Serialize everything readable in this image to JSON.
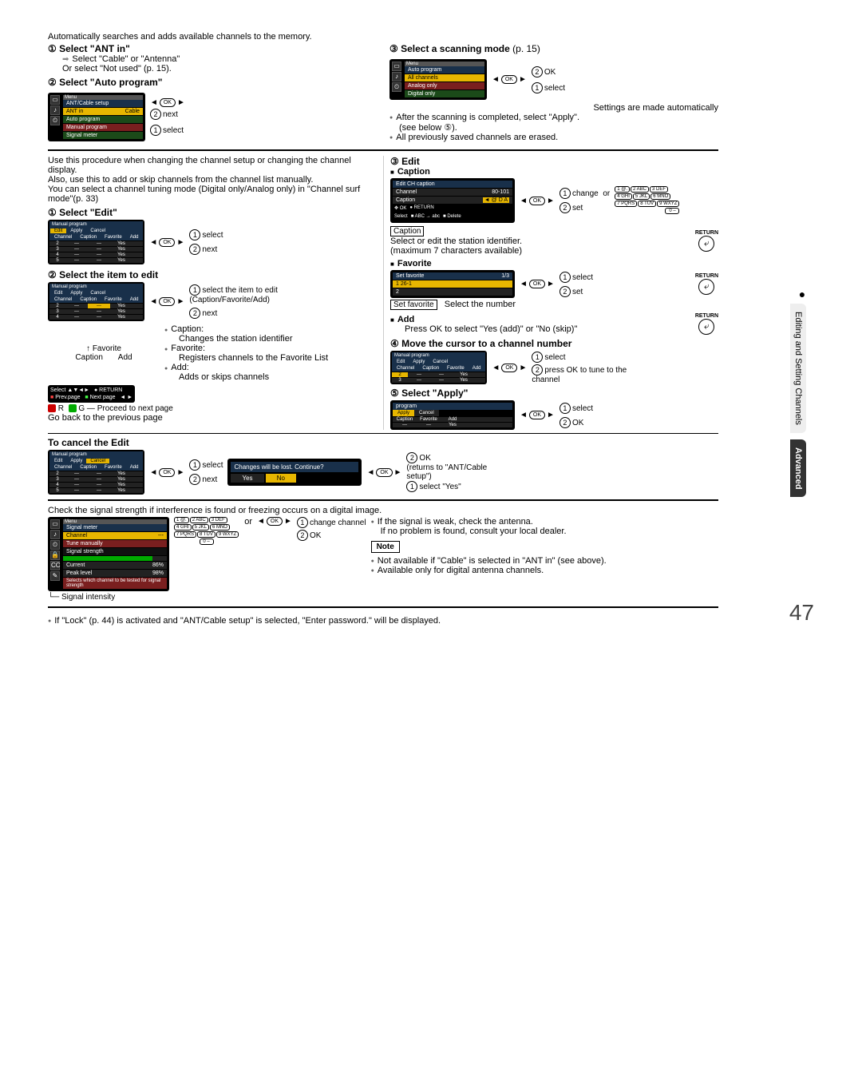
{
  "page_number": "47",
  "intro_line": "Automatically searches and adds available channels to the memory.",
  "s1": {
    "title": "① Select \"ANT in\"",
    "a": "Select \"Cable\" or \"Antenna\"",
    "b": "Or select \"Not used\" (p. 15)."
  },
  "s2": {
    "title": "② Select \"Auto program\""
  },
  "menu1": {
    "menu_label": "Menu",
    "header": "ANT/Cable setup",
    "ant_in": "ANT in",
    "ant_in_val": "Cable",
    "auto_program": "Auto program",
    "manual_program": "Manual program",
    "signal_meter": "Signal meter"
  },
  "ok_next": "next",
  "ok_select": "select",
  "s3": {
    "title": "③ Select a scanning mode",
    "ref": " (p. 15)"
  },
  "menu2": {
    "menu_label": "Menu",
    "header": "Auto program",
    "all": "All channels",
    "analog": "Analog only",
    "digital": "Digital only"
  },
  "scan_ok": "OK",
  "scan_select": "select",
  "scan_auto": "Settings are made automatically",
  "scan_note1": "After the scanning is completed, select \"Apply\".",
  "scan_note1b": "(see below ⑤).",
  "scan_note2": "All previously saved channels are erased.",
  "manual_intro1": "Use this procedure when changing the channel setup or changing the channel display.",
  "manual_intro2": "Also, use this to add or skip channels from the channel list manually.",
  "manual_intro3": "You can select a channel tuning mode (Digital only/Analog only) in \"Channel surf mode\"(p. 33)",
  "m1": {
    "title": "① Select \"Edit\""
  },
  "m1_table": {
    "header": "Manual program",
    "tabs": [
      "Edit",
      "Apply",
      "Cancel"
    ],
    "cols": [
      "Channel",
      "Caption",
      "Favorite",
      "Add"
    ],
    "rows": [
      [
        "2",
        "---",
        "---",
        "Yes"
      ],
      [
        "3",
        "---",
        "---",
        "Yes"
      ],
      [
        "4",
        "---",
        "---",
        "Yes"
      ],
      [
        "5",
        "---",
        "---",
        "Yes"
      ]
    ]
  },
  "m1_select": "select",
  "m1_next": "next",
  "m2": {
    "title": "② Select the item to edit"
  },
  "m2_select_item": "select the item to edit (Caption/Favorite/Add)",
  "m2_next": "next",
  "m2_labels": {
    "favorite": "Favorite",
    "caption": "Caption",
    "add": "Add"
  },
  "m2_bullets": {
    "caption": "Caption:",
    "caption_desc": "Changes the station identifier",
    "favorite": "Favorite:",
    "favorite_desc": "Registers channels to the Favorite List",
    "add": "Add:",
    "add_desc": "Adds or skips channels"
  },
  "m2_nav": {
    "select_ok": "Select ▲▼◄►",
    "return": "RETURN",
    "prev": "Prev.page",
    "next": "Next page",
    "r": "R",
    "g": "G",
    "proceed": "Proceed to next page",
    "goback": "Go back to the previous page"
  },
  "m3": {
    "title": "③ Edit"
  },
  "m3_caption_hdr": "Caption",
  "edit_caption_box": {
    "title": "Edit CH caption",
    "channel": "Channel",
    "channel_val": "80-101",
    "caption": "Caption",
    "caption_val": "◄ @ D A",
    "foot_select": "Select",
    "foot_ok": "OK",
    "foot_return": "RETURN",
    "foot_abc": "ABC → abc",
    "foot_delete": "Delete"
  },
  "m3_change": "change",
  "m3_or": "or",
  "m3_set": "set",
  "m3_caption_label": "Caption",
  "m3_caption_desc": "Select or edit the station identifier.",
  "m3_caption_desc2": "(maximum 7 characters available)",
  "m3_return": "RETURN",
  "m3_favorite_hdr": "Favorite",
  "fav_box": {
    "title": "Set favorite",
    "page": "1/3",
    "row1_num": "1",
    "row1_ch": "26-1",
    "row2_num": "2"
  },
  "m3_fav_select": "select",
  "m3_fav_set": "set",
  "m3_fav_setfav": "Set favorite",
  "m3_fav_selectnum": "Select the number",
  "m3_add_hdr": "Add",
  "m3_add_desc": "Press OK to select \"Yes (add)\" or \"No (skip)\"",
  "m4": {
    "title": "④ Move the cursor to a channel number"
  },
  "m4_box": {
    "header": "Manual program",
    "tabs": [
      "Edit",
      "Apply",
      "Cancel"
    ],
    "cols": [
      "Channel",
      "Caption",
      "Favorite",
      "Add"
    ],
    "rows": [
      [
        "2",
        "---",
        "---",
        "Yes"
      ],
      [
        "3",
        "---",
        "---",
        "Yes"
      ]
    ]
  },
  "m4_select": "select",
  "m4_press": "press OK to tune to the channel",
  "m5": {
    "title": "⑤ Select \"Apply\""
  },
  "m5_box": {
    "header": "program",
    "tabs": [
      "Apply",
      "Cancel"
    ],
    "cols": [
      "Caption",
      "Favorite",
      "Add"
    ],
    "row": [
      "---",
      "---",
      "Yes"
    ]
  },
  "m5_select": "select",
  "m5_ok": "OK",
  "cancel": {
    "title": "To cancel the Edit",
    "select": "select",
    "next": "next",
    "q": "Changes will be lost. Continue?",
    "yes": "Yes",
    "no": "No",
    "ok": "OK",
    "returns": "(returns to \"ANT/Cable setup\")",
    "select_yes": "select \"Yes\""
  },
  "cancel_table": {
    "header": "Manual program",
    "tabs": [
      "Edit",
      "Apply",
      "Cancel"
    ],
    "cols": [
      "Channel",
      "Caption",
      "Favorite",
      "Add"
    ],
    "rows": [
      [
        "2",
        "---",
        "---",
        "Yes"
      ],
      [
        "3",
        "---",
        "---",
        "Yes"
      ],
      [
        "4",
        "---",
        "---",
        "Yes"
      ],
      [
        "5",
        "---",
        "---",
        "Yes"
      ]
    ]
  },
  "signal": {
    "intro": "Check the signal strength if interference is found or freezing occurs on a digital image.",
    "menu_label": "Menu",
    "header": "Signal meter",
    "channel": "Channel",
    "channel_val": "---",
    "tune": "Tune manually",
    "strength": "Signal strength",
    "current": "Current",
    "current_val": "86%",
    "peak": "Peak level",
    "peak_val": "98%",
    "foot": "Selects which channel to be tested for signal strength",
    "or": "or",
    "change": "change channel",
    "ok": "OK",
    "intensity": "Signal intensity",
    "weak": "If the signal is weak, check the antenna.",
    "consult": "If no problem is found, consult your local dealer.",
    "note": "Note",
    "note1": "Not available if \"Cable\" is selected in \"ANT in\" (see above).",
    "note2": "Available only for digital antenna channels."
  },
  "numpad": {
    "k1": "1 @.",
    "k2": "2 ABC",
    "k3": "3 DEF",
    "k4": "4 GHI",
    "k5": "5 JKL",
    "k6": "6 MNO",
    "k7": "7 PQRS",
    "k8": "8 TUV",
    "k9": "9 WXYZ",
    "k0": "0 –"
  },
  "footer_note": "If \"Lock\" (p. 44) is activated and \"ANT/Cable setup\" is selected, \"Enter password.\" will be displayed.",
  "side_tab1": "Editing and Setting Channels",
  "side_tab2": "Advanced"
}
